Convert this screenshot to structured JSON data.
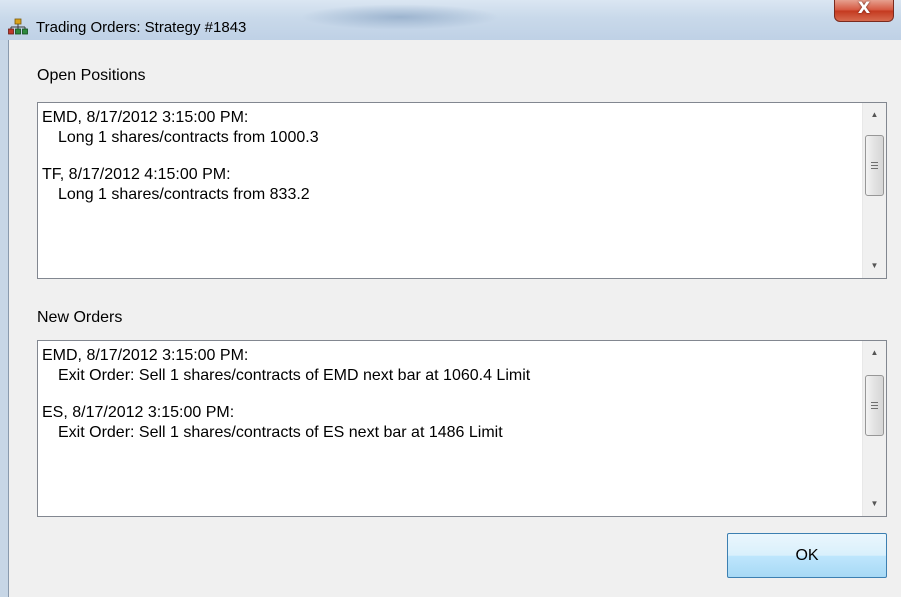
{
  "window": {
    "title": "Trading Orders: Strategy #1843",
    "close_glyph": "X"
  },
  "open_positions": {
    "label": "Open Positions",
    "entries": [
      {
        "header": "EMD, 8/17/2012 3:15:00 PM:",
        "detail": "Long 1 shares/contracts from 1000.3"
      },
      {
        "header": "TF, 8/17/2012 4:15:00 PM:",
        "detail": "Long 1 shares/contracts from 833.2"
      }
    ]
  },
  "new_orders": {
    "label": "New Orders",
    "entries": [
      {
        "header": "EMD, 8/17/2012 3:15:00 PM:",
        "detail": "Exit Order: Sell 1 shares/contracts of EMD next bar at 1060.4 Limit"
      },
      {
        "header": "ES, 8/17/2012 3:15:00 PM:",
        "detail": "Exit Order: Sell 1 shares/contracts of ES next bar at 1486 Limit"
      }
    ]
  },
  "buttons": {
    "ok": "OK"
  },
  "icons": {
    "app": "network-icon",
    "close": "close-icon",
    "scroll_up": "scroll-up-arrow-icon",
    "scroll_down": "scroll-down-arrow-icon"
  },
  "colors": {
    "close_button": "#c4391f",
    "ok_border": "#3c7fb1",
    "title_bar": "#c9d9ea"
  }
}
